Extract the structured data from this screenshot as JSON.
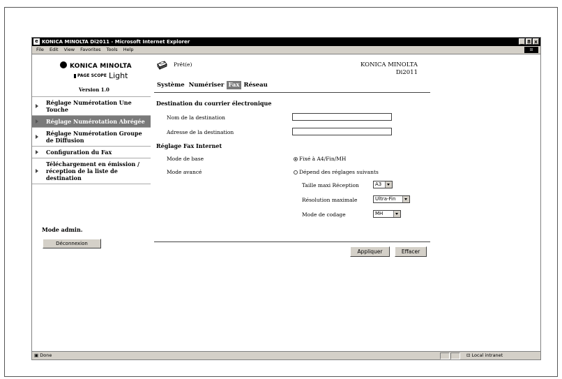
{
  "window": {
    "title": "KONICA MINOLTA Di2011 - Microsoft Internet Explorer",
    "controls": [
      "_",
      "8",
      "x"
    ],
    "menu": [
      "File",
      "Edit",
      "View",
      "Favorites",
      "Tools",
      "Help"
    ],
    "status_left": "Done",
    "status_zone": "Local intranet"
  },
  "sidebar": {
    "logo_brand": "KONICA MINOLTA",
    "logo_product_prefix": "PAGE SCOPE",
    "logo_product": "Light",
    "version": "Version 1.0",
    "items": [
      {
        "label": "Réglage Numérotation Une Touche",
        "active": false
      },
      {
        "label": "Réglage Numérotation Abrégée",
        "active": true
      },
      {
        "label": "Réglage Numérotation Groupe de Diffusion",
        "active": false
      },
      {
        "label": "Configuration du Fax",
        "active": false
      },
      {
        "label": "Téléchargement en émission / réception de la liste de destination",
        "active": false
      }
    ],
    "admin_label": "Mode admin.",
    "logout_label": "Déconnexion"
  },
  "main": {
    "status": "Prêt(e)",
    "brand_line1": "KONICA MINOLTA",
    "brand_line2": "Di2011",
    "tabs": [
      {
        "label": "Système",
        "active": false
      },
      {
        "label": "Numériser",
        "active": false
      },
      {
        "label": "Fax",
        "active": true
      },
      {
        "label": "Réseau",
        "active": false
      }
    ],
    "email_section": "Destination du courrier électronique",
    "dest_name_label": "Nom de la destination",
    "dest_name_value": "",
    "dest_addr_label": "Adresse de la destination",
    "dest_addr_value": "",
    "ifax_section": "Réglage Fax Internet",
    "basic_mode_label": "Mode de base",
    "basic_mode_option": "Fixé à A4/Fin/MH",
    "advanced_mode_label": "Mode avancé",
    "advanced_mode_option": "Dépend des réglages suivants",
    "selected_mode": "basic",
    "max_size_label": "Taille maxi Réception",
    "max_size_value": "A3",
    "max_res_label": "Résolution maximale",
    "max_res_value": "Ultra-Fin",
    "coding_label": "Mode de codage",
    "coding_value": "MH",
    "apply_label": "Appliquer",
    "clear_label": "Effacer"
  }
}
